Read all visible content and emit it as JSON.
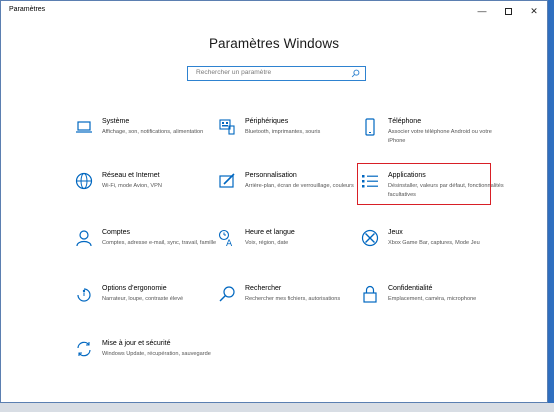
{
  "window": {
    "title": "Paramètres"
  },
  "heading": "Paramètres Windows",
  "search": {
    "placeholder": "Rechercher un paramètre"
  },
  "tiles": [
    {
      "name": "Système",
      "desc": "Affichage, son, notifications, alimentation",
      "icon": "laptop-icon"
    },
    {
      "name": "Périphériques",
      "desc": "Bluetooth, imprimantes, souris",
      "icon": "keyboard-icon"
    },
    {
      "name": "Téléphone",
      "desc": "Associer votre téléphone Android ou votre iPhone",
      "icon": "phone-icon"
    },
    {
      "name": "Réseau et Internet",
      "desc": "Wi-Fi, mode Avion, VPN",
      "icon": "globe-icon"
    },
    {
      "name": "Personnalisation",
      "desc": "Arrière-plan, écran de verrouillage, couleurs",
      "icon": "paint-icon"
    },
    {
      "name": "Applications",
      "desc": "Désinstaller, valeurs par défaut, fonctionnalités facultatives",
      "icon": "apps-list-icon"
    },
    {
      "name": "Comptes",
      "desc": "Comptes, adresse e-mail, sync, travail, famille",
      "icon": "person-icon"
    },
    {
      "name": "Heure et langue",
      "desc": "Voix, région, date",
      "icon": "time-language-icon"
    },
    {
      "name": "Jeux",
      "desc": "Xbox Game Bar, captures, Mode Jeu",
      "icon": "xbox-icon"
    },
    {
      "name": "Options d’ergonomie",
      "desc": "Narrateur, loupe, contraste élevé",
      "icon": "ease-of-access-icon"
    },
    {
      "name": "Rechercher",
      "desc": "Rechercher mes fichiers, autorisations",
      "icon": "search-icon"
    },
    {
      "name": "Confidentialité",
      "desc": "Emplacement, caméra, microphone",
      "icon": "lock-icon"
    },
    {
      "name": "Mise à jour et sécurité",
      "desc": "Windows Update, récupération, sauvegarde",
      "icon": "update-icon"
    }
  ],
  "colors": {
    "accent": "#0067c0",
    "highlight": "#d81f26"
  }
}
